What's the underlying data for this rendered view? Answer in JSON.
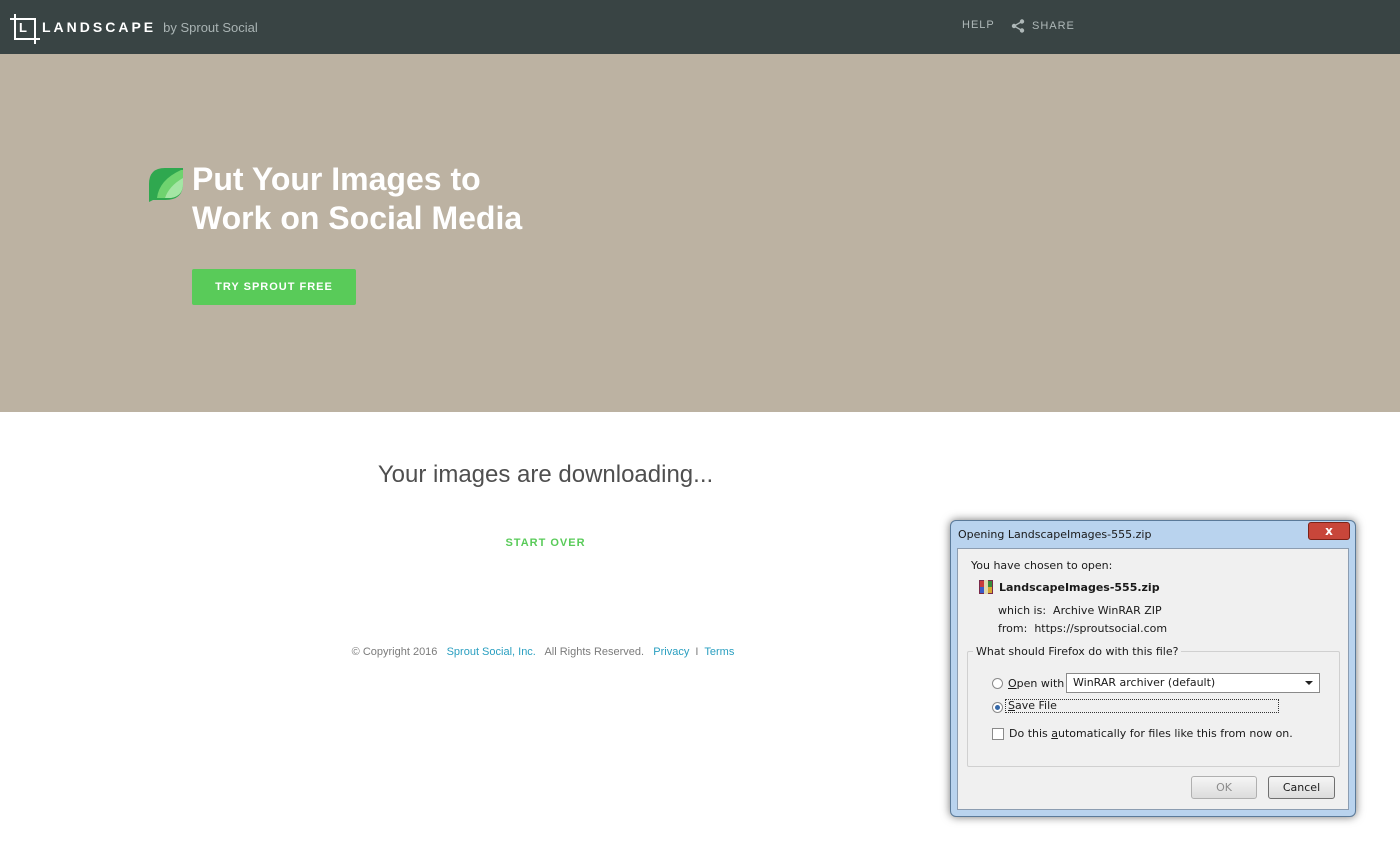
{
  "header": {
    "logo_text": "LANDSCAPE",
    "logo_by": "by Sprout Social",
    "nav_help": "HELP",
    "nav_share": "SHARE"
  },
  "hero": {
    "title_line1": "Put Your Images to",
    "title_line2": "Work on Social Media",
    "cta": "TRY SPROUT FREE"
  },
  "main": {
    "status": "Your images are downloading...",
    "start_over": "START OVER"
  },
  "footer": {
    "copyright": "© Copyright 2016",
    "company": "Sprout Social, Inc.",
    "rights": "All Rights Reserved.",
    "privacy": "Privacy",
    "separator": "I",
    "terms": "Terms"
  },
  "dialog": {
    "title": "Opening LandscapeImages-555.zip",
    "close": "x",
    "chosen_text": "You have chosen to open:",
    "file_name": "LandscapeImages-555.zip",
    "which_is_label": "which is:",
    "which_is_value": "Archive WinRAR ZIP",
    "from_label": "from:",
    "from_value": "https://sproutsocial.com",
    "question": "What should Firefox do with this file?",
    "open_with_pre": "",
    "open_with_u": "O",
    "open_with_post": "pen with",
    "open_with_app": "WinRAR archiver (default)",
    "save_file_u": "S",
    "save_file_post": "ave File",
    "auto_pre": "Do this ",
    "auto_u": "a",
    "auto_post": "utomatically for files like this from now on.",
    "ok": "OK",
    "cancel": "Cancel",
    "selected_option": "Save File"
  },
  "colors": {
    "header_bg": "#394444",
    "hero_bg": "#bcb2a2",
    "accent_green": "#59cb59",
    "link_blue": "#2a9fc0"
  }
}
